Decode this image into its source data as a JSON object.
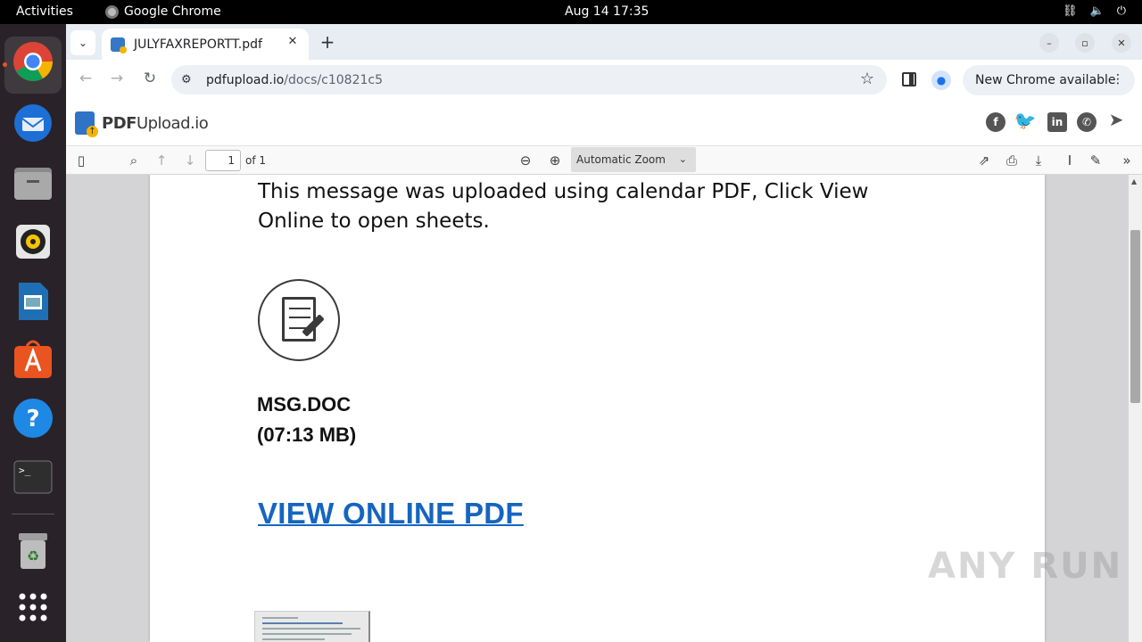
{
  "topbar": {
    "activities": "Activities",
    "app_name": "Google Chrome",
    "clock": "Aug 14  17:35"
  },
  "dock": {
    "items": [
      "chrome-icon",
      "thunderbird-icon",
      "files-icon",
      "rhythmbox-icon",
      "writer-icon",
      "app-center-icon",
      "help-icon",
      "terminal-icon",
      "trash-icon",
      "app-grid-icon"
    ]
  },
  "browser": {
    "tab_title": "JULYFAXREPORTT.pdf",
    "url_host": "pdfupload.io",
    "url_path": "/docs/c10821c5",
    "update_label": "New Chrome available"
  },
  "site": {
    "brand_bold": "PDF",
    "brand_rest": "Upload.io",
    "share_icons": [
      "facebook-icon",
      "twitter-icon",
      "linkedin-icon",
      "whatsapp-icon",
      "telegram-icon"
    ]
  },
  "pdf_toolbar": {
    "page_number": "1",
    "page_of": "of 1",
    "zoom": "Automatic Zoom"
  },
  "pdf_content": {
    "message": "This message was uploaded using calendar PDF, Click View Online to open sheets.",
    "file_name": "MSG.DOC",
    "file_size": "(07:13 MB)",
    "view_link": "VIEW ONLINE PDF"
  },
  "watermark": "ANY RUN",
  "colors": {
    "link": "#1565c0",
    "dock_bg": "#2a2229",
    "accent": "#e95420"
  }
}
